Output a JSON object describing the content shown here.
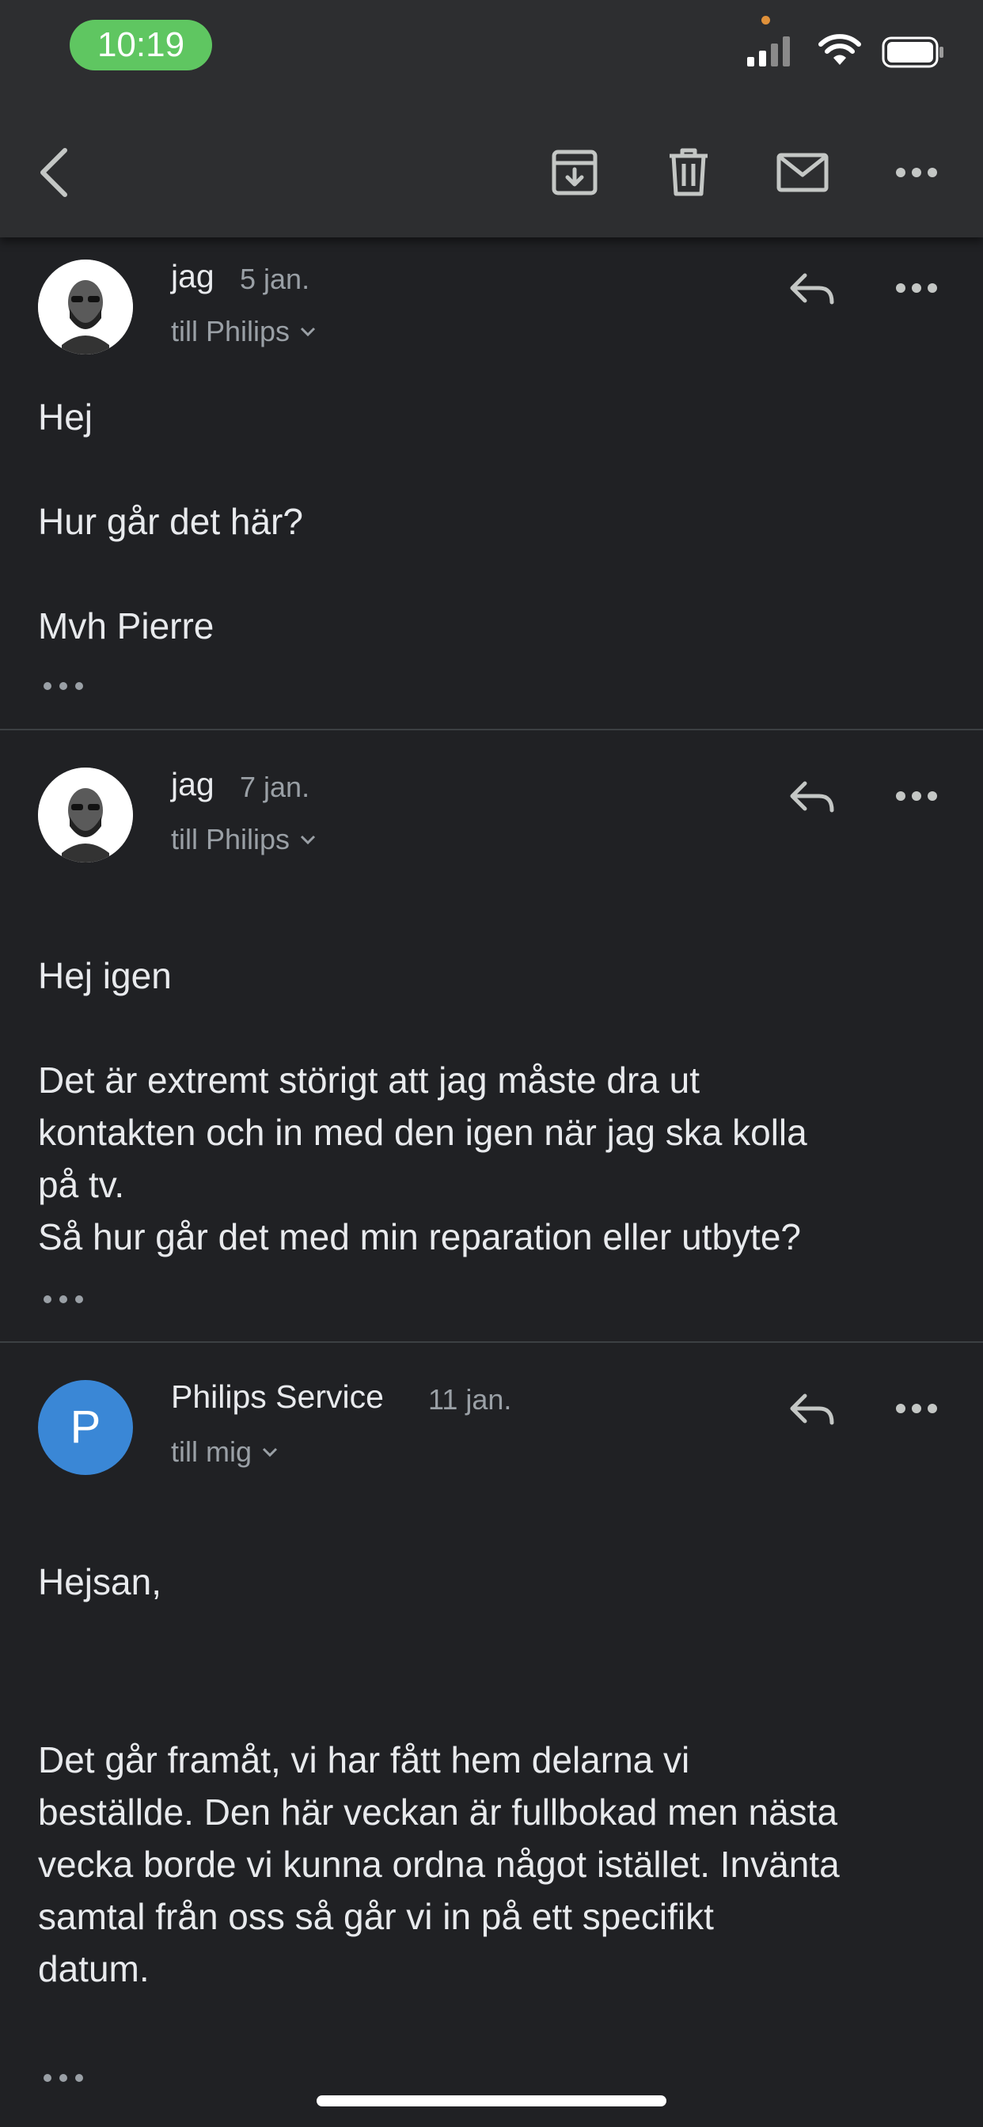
{
  "status_bar": {
    "time": "10:19"
  },
  "toolbar": {
    "back_icon": "chevron-left-icon",
    "archive_icon": "archive-icon",
    "delete_icon": "trash-icon",
    "mark_unread_icon": "mail-icon",
    "more_icon": "more-horizontal-icon"
  },
  "messages": [
    {
      "sender": "jag",
      "date": "5 jan.",
      "recipient": "till Philips",
      "avatar": "photo",
      "body": "Hej\n\nHur går det här?\n\nMvh Pierre"
    },
    {
      "sender": "jag",
      "date": "7 jan.",
      "recipient": "till Philips",
      "avatar": "photo",
      "body": "Hej igen\n\nDet är extremt störigt att jag måste dra ut\nkontakten och in med den igen när jag ska kolla\npå tv.\nSå hur går det med min reparation eller utbyte?"
    },
    {
      "sender": "Philips Service",
      "date": "11 jan.",
      "recipient": "till mig",
      "avatar_letter": "P",
      "body_greeting": "Hejsan,",
      "body": "Det går framåt, vi har fått hem delarna vi\nbeställde. Den här veckan är fullbokad men nästa\nvecka borde vi kunna ordna något istället. Invänta\nsamtal från oss så går vi in på ett specifikt\ndatum."
    }
  ],
  "colors": {
    "background": "#202124",
    "header": "#2d2e30",
    "avatar_blue": "#3a87d6",
    "time_pill": "#5fc661"
  }
}
